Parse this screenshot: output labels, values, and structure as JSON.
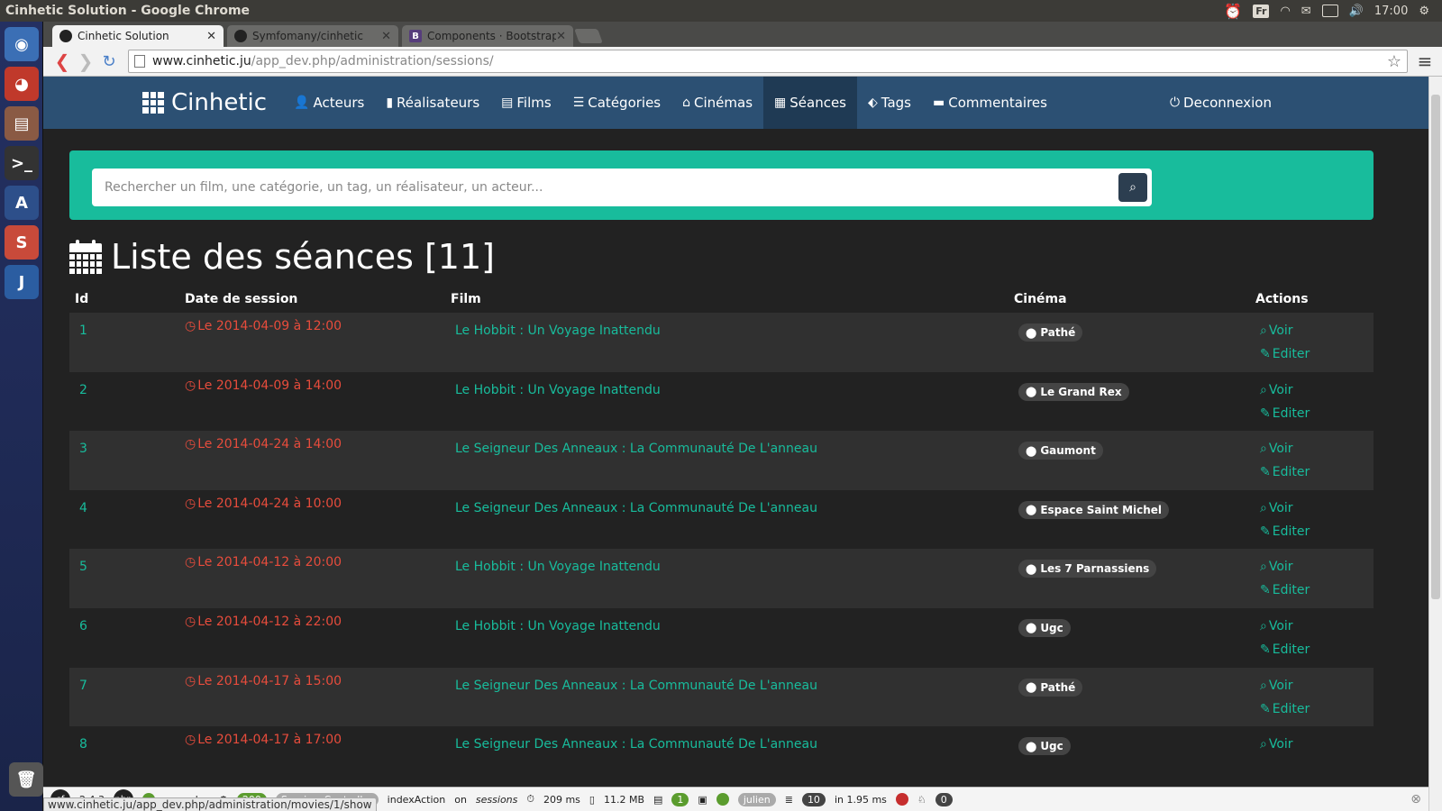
{
  "os": {
    "window_title": "Cinhetic Solution - Google Chrome",
    "tray": {
      "lang": "Fr",
      "clock": "17:00"
    }
  },
  "browser": {
    "tabs": [
      {
        "label": "Cinhetic Solution",
        "icon": "github-icon",
        "active": true
      },
      {
        "label": "Symfomany/cinhetic",
        "icon": "github-icon",
        "active": false
      },
      {
        "label": "Components · Bootstrap",
        "icon": "bootstrap-icon",
        "active": false
      }
    ],
    "url_host": "www.cinhetic.ju",
    "url_path": "/app_dev.php/administration/sessions/",
    "status_url": "www.cinhetic.ju/app_dev.php/administration/movies/1/show"
  },
  "navbar": {
    "brand": "Cinhetic",
    "items": [
      {
        "label": "Acteurs",
        "icon": "user-icon",
        "glyph": "👤"
      },
      {
        "label": "Réalisateurs",
        "icon": "video-camera-icon",
        "glyph": "▮"
      },
      {
        "label": "Films",
        "icon": "film-icon",
        "glyph": "▤"
      },
      {
        "label": "Catégories",
        "icon": "list-icon",
        "glyph": "☰"
      },
      {
        "label": "Cinémas",
        "icon": "home-icon",
        "glyph": "⌂"
      },
      {
        "label": "Séances",
        "icon": "calendar-icon",
        "glyph": "▦",
        "active": true
      },
      {
        "label": "Tags",
        "icon": "tags-icon",
        "glyph": "⬖"
      },
      {
        "label": "Commentaires",
        "icon": "comment-icon",
        "glyph": "▬"
      }
    ],
    "logout": "Deconnexion"
  },
  "search": {
    "placeholder": "Rechercher un film, une catégorie, un tag, un réalisateur, un acteur..."
  },
  "page": {
    "title": "Liste des séances [11]"
  },
  "table": {
    "headers": {
      "id": "Id",
      "date": "Date de session",
      "film": "Film",
      "cinema": "Cinéma",
      "actions": "Actions"
    },
    "action_view": "Voir",
    "action_edit": "Editer",
    "rows": [
      {
        "id": "1",
        "date": "Le 2014-04-09 à 12:00",
        "film": "Le Hobbit : Un Voyage Inattendu",
        "cinema": "Pathé"
      },
      {
        "id": "2",
        "date": "Le 2014-04-09 à 14:00",
        "film": "Le Hobbit : Un Voyage Inattendu",
        "cinema": "Le Grand Rex"
      },
      {
        "id": "3",
        "date": "Le 2014-04-24 à 14:00",
        "film": "Le Seigneur Des Anneaux : La Communauté De L'anneau",
        "cinema": "Gaumont"
      },
      {
        "id": "4",
        "date": "Le 2014-04-24 à 10:00",
        "film": "Le Seigneur Des Anneaux : La Communauté De L'anneau",
        "cinema": "Espace Saint Michel"
      },
      {
        "id": "5",
        "date": "Le 2014-04-12 à 20:00",
        "film": "Le Hobbit : Un Voyage Inattendu",
        "cinema": "Les 7 Parnassiens"
      },
      {
        "id": "6",
        "date": "Le 2014-04-12 à 22:00",
        "film": "Le Hobbit : Un Voyage Inattendu",
        "cinema": "Ugc"
      },
      {
        "id": "7",
        "date": "Le 2014-04-17 à 15:00",
        "film": "Le Seigneur Des Anneaux : La Communauté De L'anneau",
        "cinema": "Pathé"
      },
      {
        "id": "8",
        "date": "Le 2014-04-17 à 17:00",
        "film": "Le Seigneur Des Anneaux : La Communauté De L'anneau",
        "cinema": "Ugc"
      }
    ]
  },
  "sf_toolbar": {
    "version": "2.4.3",
    "controller": "SessionsController",
    "action": "indexAction",
    "route_prefix": "on",
    "route": "sessions",
    "time": "209 ms",
    "memory": "11.2 MB",
    "logs": "1",
    "user": "julien",
    "queries": "10",
    "query_time": "in 1.95 ms",
    "count": "0",
    "env": "dev",
    "app": "app",
    "status": "200"
  },
  "colors": {
    "navbar": "#2c5073",
    "accent": "#18bc9c",
    "date": "#e74c3c",
    "background": "#222222"
  }
}
